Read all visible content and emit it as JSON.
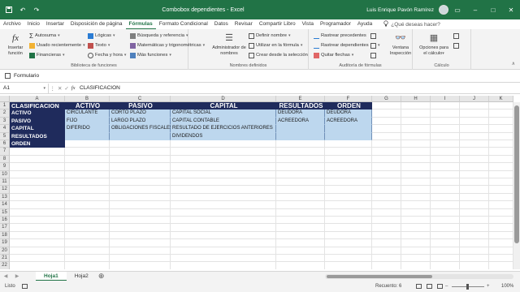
{
  "window": {
    "title": "Combobox dependientes  -  Excel",
    "user": "Luis Enrique Pavón Ramírez",
    "icons": [
      "save-icon",
      "undo-icon",
      "redo-icon"
    ]
  },
  "tabs": [
    "Archivo",
    "Inicio",
    "Insertar",
    "Disposición de página",
    "Fórmulas",
    "Formato Condicional",
    "Datos",
    "Revisar",
    "Compartir Libro",
    "Vista",
    "Programador",
    "Ayuda"
  ],
  "active_tab": "Fórmulas",
  "tell_me": "¿Qué deseas hacer?",
  "ribbon": {
    "insert_function": "Insertar función",
    "autosum": "Autosuma",
    "recent": "Usado recientemente",
    "financial": "Financieras",
    "logical": "Lógicas",
    "text": "Texto",
    "datetime": "Fecha y hora",
    "lookup": "Búsqueda y referencia",
    "math": "Matemáticas y trigonométricas",
    "more": "Más funciones",
    "group_library": "Biblioteca de funciones",
    "name_manager": "Administrador de nombres",
    "define_name": "Definir nombre",
    "use_in_formula": "Utilizar en la fórmula",
    "create_from_selection": "Crear desde la selección",
    "group_names": "Nombres definidos",
    "trace_precedents": "Rastrear precedentes",
    "trace_dependents": "Rastrear dependientes",
    "remove_arrows": "Quitar flechas",
    "watch_window": "Ventana Inspección",
    "group_audit": "Auditoría de fórmulas",
    "calc_options": "Opciones para el cálculo",
    "group_calc": "Cálculo"
  },
  "formula_bar_tab": "Formulario",
  "name_box": "A1",
  "formula": "CLASIFICACION",
  "columns": [
    "A",
    "B",
    "C",
    "D",
    "E",
    "F",
    "G",
    "H",
    "I",
    "J",
    "K"
  ],
  "rows": [
    "1",
    "2",
    "3",
    "4",
    "5",
    "6",
    "7",
    "8",
    "9",
    "10",
    "11",
    "12",
    "13",
    "14",
    "15",
    "16",
    "17",
    "18",
    "19",
    "20",
    "21",
    "22"
  ],
  "header_row": [
    "CLASIFICACION",
    "ACTIVO",
    "PASIVO",
    "CAPITAL",
    "RESULTADOS",
    "ORDEN"
  ],
  "col_a": [
    "ACTIVO",
    "PASIVO",
    "CAPITAL",
    "RESULTADOS",
    "ORDEN"
  ],
  "col_b": [
    "CIRCULANTE",
    "FIJO",
    "DIFERIDO"
  ],
  "col_c": [
    "CORTO PLAZO",
    "LARGO PLAZO",
    "OBLIGACIONES FISCALES"
  ],
  "col_d": [
    "CAPITAL SOCIAL",
    "CAPITAL CONTABLE",
    "RESULTADO DE EJERCICIOS ANTERIORES",
    "DIVIDENDOS"
  ],
  "col_e": [
    "DEUDORA",
    "ACREEDORA"
  ],
  "col_f": [
    "DEUDORA",
    "ACREEDORA"
  ],
  "sheets": [
    "Hoja1",
    "Hoja2"
  ],
  "active_sheet": "Hoja1",
  "status": {
    "mode": "Listo",
    "count": "Recuento: 6",
    "zoom": "100%"
  }
}
